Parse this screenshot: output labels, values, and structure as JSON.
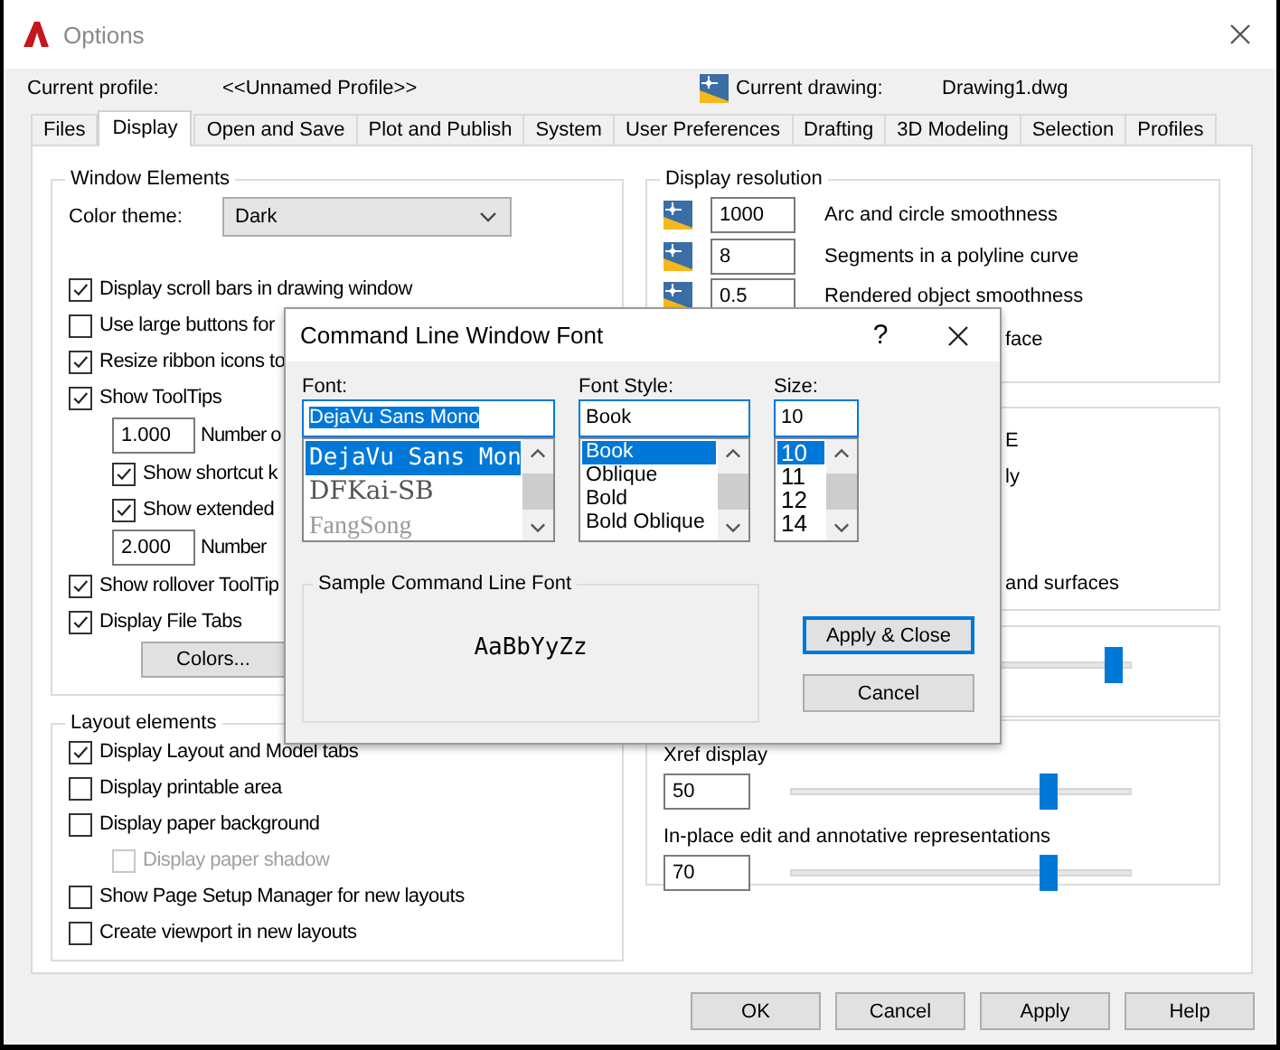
{
  "window": {
    "title": "Options"
  },
  "profile": {
    "label": "Current profile:",
    "value": "<<Unnamed Profile>>",
    "drawing_label": "Current drawing:",
    "drawing_value": "Drawing1.dwg"
  },
  "tabs": [
    {
      "label": "Files",
      "selected": false
    },
    {
      "label": "Display",
      "selected": true
    },
    {
      "label": "Open and Save",
      "selected": false
    },
    {
      "label": "Plot and Publish",
      "selected": false
    },
    {
      "label": "System",
      "selected": false
    },
    {
      "label": "User Preferences",
      "selected": false
    },
    {
      "label": "Drafting",
      "selected": false
    },
    {
      "label": "3D Modeling",
      "selected": false
    },
    {
      "label": "Selection",
      "selected": false
    },
    {
      "label": "Profiles",
      "selected": false
    }
  ],
  "window_elements": {
    "title": "Window Elements",
    "color_theme": {
      "label": "Color theme:",
      "value": "Dark"
    },
    "items": [
      {
        "kind": "check",
        "label": "Display scroll bars in drawing window",
        "checked": true
      },
      {
        "kind": "check",
        "label": "Use large buttons for",
        "checked": false
      },
      {
        "kind": "check",
        "label": "Resize ribbon icons to",
        "checked": true
      },
      {
        "kind": "check",
        "label": "Show ToolTips",
        "checked": true,
        "children": [
          {
            "kind": "number",
            "value": "1.000",
            "label": "Number o"
          },
          {
            "kind": "check",
            "label": "Show shortcut k",
            "checked": true
          },
          {
            "kind": "check",
            "label": "Show extended",
            "checked": true
          },
          {
            "kind": "number",
            "value": "2.000",
            "label": "Number"
          }
        ]
      },
      {
        "kind": "check",
        "label": "Show rollover ToolTip",
        "checked": true
      },
      {
        "kind": "check",
        "label": "Display File Tabs",
        "checked": true
      },
      {
        "kind": "button",
        "label": "Colors..."
      }
    ]
  },
  "layout_elements": {
    "title": "Layout elements",
    "items": [
      {
        "kind": "check",
        "label": "Display Layout and Model tabs",
        "checked": true,
        "disabled": false
      },
      {
        "kind": "check",
        "label": "Display printable area",
        "checked": false,
        "disabled": false
      },
      {
        "kind": "check",
        "label": "Display paper background",
        "checked": false,
        "disabled": false,
        "children": [
          {
            "kind": "check",
            "label": "Display paper shadow",
            "checked": false,
            "disabled": true
          }
        ]
      },
      {
        "kind": "check",
        "label": "Show Page Setup Manager for new layouts",
        "checked": false,
        "disabled": false
      },
      {
        "kind": "check",
        "label": "Create viewport in new layouts",
        "checked": false,
        "disabled": false
      }
    ]
  },
  "display_resolution": {
    "title": "Display resolution",
    "rows": [
      {
        "kind": "field",
        "value": "1000",
        "label": "Arc and circle smoothness"
      },
      {
        "kind": "field",
        "value": "8",
        "label": "Segments in a polyline curve"
      },
      {
        "kind": "field",
        "value": "0.5",
        "label": "Rendered object smoothness"
      },
      {
        "kind": "text",
        "label": "face"
      }
    ]
  },
  "group_2": {
    "texts": [
      "E",
      "ly",
      "and surfaces"
    ]
  },
  "group_3": {
    "slider": {
      "level": 0.95
    }
  },
  "fade_control": {
    "rows": [
      {
        "label": "Xref display",
        "value": "50",
        "level": 0.76
      },
      {
        "label": "In-place edit and annotative representations",
        "value": "70",
        "level": 0.76
      }
    ]
  },
  "buttons": [
    "OK",
    "Cancel",
    "Apply",
    "Help"
  ],
  "dialog": {
    "title": "Command Line Window Font",
    "help": "?",
    "font": {
      "label": "Font:",
      "value": "DejaVu Sans Mono",
      "items": [
        {
          "label": "DejaVu Sans Mon",
          "selected": true
        },
        {
          "label": "DFKai-SB",
          "selected": false
        },
        {
          "label": "FangSong",
          "selected": false
        }
      ]
    },
    "style": {
      "label": "Font Style:",
      "value": "Book",
      "items": [
        {
          "label": "Book",
          "selected": true
        },
        {
          "label": "Oblique",
          "selected": false
        },
        {
          "label": "Bold",
          "selected": false
        },
        {
          "label": "Bold Oblique",
          "selected": false
        }
      ]
    },
    "size": {
      "label": "Size:",
      "value": "10",
      "items": [
        {
          "label": "10",
          "selected": true
        },
        {
          "label": "11",
          "selected": false
        },
        {
          "label": "12",
          "selected": false
        },
        {
          "label": "14",
          "selected": false
        }
      ]
    },
    "sample": {
      "title": "Sample Command Line Font",
      "text": "AaBbYyZz"
    },
    "buttons": [
      {
        "label": "Apply & Close",
        "focused": true
      },
      {
        "label": "Cancel",
        "focused": false
      }
    ]
  }
}
